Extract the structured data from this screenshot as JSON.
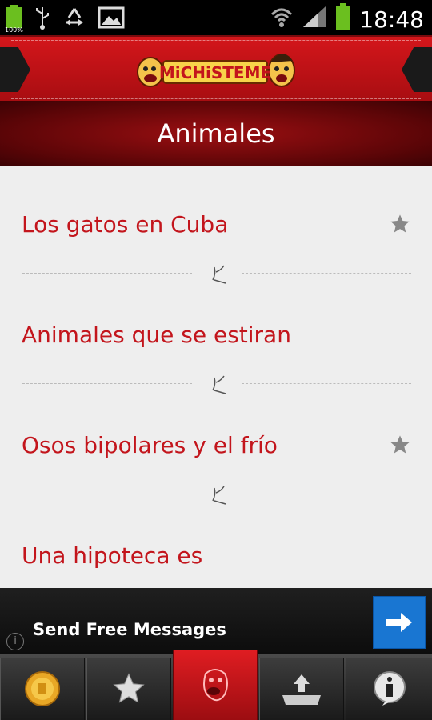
{
  "status_bar": {
    "battery_left_label": "100%",
    "time": "18:48"
  },
  "header": {
    "logo_text": "MiCHiSTEME"
  },
  "page": {
    "title": "Animales"
  },
  "jokes": [
    {
      "title": "Los gatos en Cuba",
      "starred": true
    },
    {
      "title": "Animales que se estiran",
      "starred": false
    },
    {
      "title": "Osos bipolares y el frío",
      "starred": true
    },
    {
      "title": "Una hipoteca es",
      "starred": false
    }
  ],
  "ad": {
    "text": "Send Free Messages",
    "button_icon": "arrow-right-icon",
    "info_icon": "info-icon"
  },
  "tabs": [
    {
      "name": "coin-icon"
    },
    {
      "name": "star-icon"
    },
    {
      "name": "laughing-face-icon"
    },
    {
      "name": "share-icon"
    },
    {
      "name": "info-icon"
    }
  ],
  "colors": {
    "accent_red": "#c3151c",
    "header_red": "#d4161b",
    "ad_blue": "#1976d2"
  }
}
